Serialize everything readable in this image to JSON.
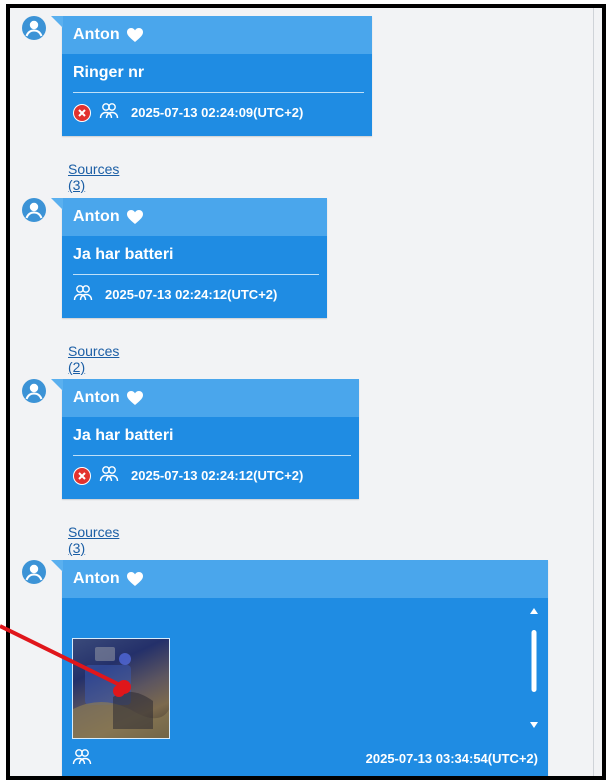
{
  "messages": [
    {
      "sender": "Anton",
      "text": "Ringer nr",
      "timestamp": "2025-07-13 02:24:09(UTC+2)",
      "failed": true,
      "sources": "Sources (3)"
    },
    {
      "sender": "Anton",
      "text": "Ja har batteri",
      "timestamp": "2025-07-13 02:24:12(UTC+2)",
      "failed": false,
      "sources": "Sources (2)"
    },
    {
      "sender": "Anton",
      "text": "Ja har batteri",
      "timestamp": "2025-07-13 02:24:12(UTC+2)",
      "failed": true,
      "sources": "Sources (3)"
    },
    {
      "sender": "Anton",
      "attachment": "image",
      "timestamp": "2025-07-13 03:34:54(UTC+2)"
    }
  ],
  "icons": {
    "avatar": "person-avatar-icon",
    "heart": "heart-icon",
    "failed": "failed-x-icon",
    "participants": "participants-icon"
  },
  "colors": {
    "bubble": "#1f8ce3",
    "bubble_header": "#4aa6ec",
    "link": "#1b5ea5",
    "failed": "#e2322f",
    "annotation_arrow": "#e0161b"
  }
}
